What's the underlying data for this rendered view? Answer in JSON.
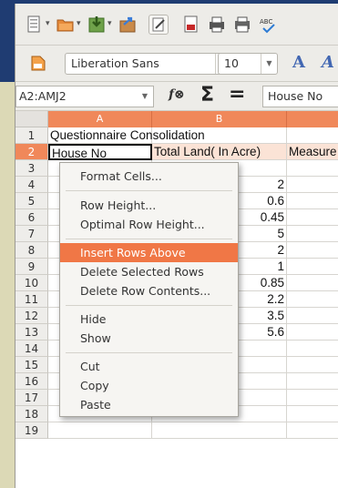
{
  "toolbar": {
    "icons": [
      "new-document-icon",
      "open-folder-icon",
      "save-icon",
      "export-icon",
      "edit-file-icon",
      "export-pdf-icon",
      "print-icon",
      "print-preview-icon",
      "spellcheck-icon"
    ],
    "fill_color_icon": "fill-color-icon",
    "font_name": "Liberation Sans",
    "font_size": "10",
    "font_color_glyphs": [
      "A",
      "A"
    ]
  },
  "formula_bar": {
    "name_box": "A2:AMJ2",
    "fx_glyph": "f⊗",
    "sum_glyph": "Σ",
    "equals_glyph": "=",
    "input_value": "House No"
  },
  "columns": [
    "A",
    "B"
  ],
  "rows": [
    {
      "num": "1",
      "a": "Questionnaire Consolidation",
      "b": "",
      "c": ""
    },
    {
      "num": "2",
      "a": "House No",
      "b": "Total Land( In Acre)",
      "c": "Measure"
    },
    {
      "num": "3",
      "a": "",
      "b": "",
      "c": ""
    },
    {
      "num": "4",
      "a": "",
      "b": "2",
      "c": ""
    },
    {
      "num": "5",
      "a": "",
      "b": "0.6",
      "c": ""
    },
    {
      "num": "6",
      "a": "",
      "b": "0.45",
      "c": ""
    },
    {
      "num": "7",
      "a": "",
      "b": "5",
      "c": ""
    },
    {
      "num": "8",
      "a": "",
      "b": "2",
      "c": ""
    },
    {
      "num": "9",
      "a": "",
      "b": "1",
      "c": ""
    },
    {
      "num": "10",
      "a": "",
      "b": "0.85",
      "c": ""
    },
    {
      "num": "11",
      "a": "",
      "b": "2.2",
      "c": ""
    },
    {
      "num": "12",
      "a": "",
      "b": "3.5",
      "c": ""
    },
    {
      "num": "13",
      "a": "",
      "b": "5.6",
      "c": ""
    },
    {
      "num": "14",
      "a": "",
      "b": "",
      "c": ""
    },
    {
      "num": "15",
      "a": "",
      "b": "",
      "c": ""
    },
    {
      "num": "16",
      "a": "",
      "b": "",
      "c": ""
    },
    {
      "num": "17",
      "a": "",
      "b": "",
      "c": ""
    },
    {
      "num": "18",
      "a": "",
      "b": "",
      "c": ""
    },
    {
      "num": "19",
      "a": "",
      "b": "",
      "c": ""
    }
  ],
  "context_menu": {
    "items": [
      "Format Cells...",
      "Row Height...",
      "Optimal Row Height...",
      "Insert Rows Above",
      "Delete Selected Rows",
      "Delete Row Contents...",
      "Hide",
      "Show",
      "Cut",
      "Copy",
      "Paste"
    ],
    "highlighted": "Insert Rows Above"
  },
  "colors": {
    "accent_orange": "#f0885a",
    "menu_highlight": "#f07746",
    "background_frame": "#1f3c72"
  }
}
